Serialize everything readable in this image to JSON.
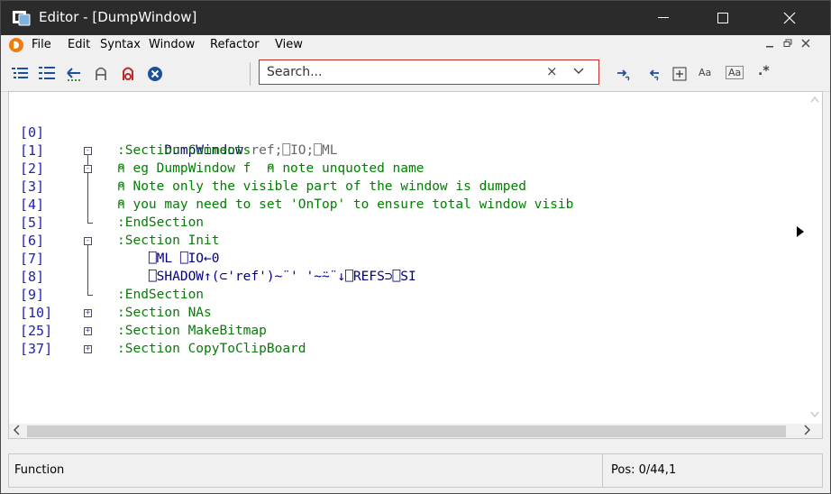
{
  "window": {
    "title": "Editor - [DumpWindow]"
  },
  "menu": {
    "items": [
      "File",
      "Edit",
      "Syntax",
      "Window",
      "Refactor",
      "View"
    ]
  },
  "toolbar": {
    "icons": [
      "outline-list-icon",
      "outline-list-alt-icon",
      "go-back-icon",
      "lock-icon",
      "unlock-icon",
      "cancel-icon"
    ],
    "search": {
      "placeholder": "Search...",
      "clear_glyph": "×"
    },
    "find_options": [
      "find-next-icon",
      "find-previous-icon",
      "expand-box-icon"
    ],
    "match_case_label": "Aa",
    "whole_word_label": "Aa",
    "regex_label": ".*"
  },
  "editor": {
    "line_numbers": [
      "[0]",
      "[1]",
      "[2]",
      "[3]",
      "[4]",
      "[5]",
      "[6]",
      "[7]",
      "[8]",
      "[9]",
      "[10]",
      "[25]",
      "[37]"
    ],
    "lines": {
      "l0": {
        "name": "DumpWindow",
        "args": " ref;⎕IO;⎕ML"
      },
      "l1": ":Section Comments",
      "l2": "⍝ eg DumpWindow f  ⍝ note unquoted name",
      "l3": "⍝ Note only the visible part of the window is dumped",
      "l4": "⍝ you may need to set 'OnTop' to ensure total window visib",
      "l5": ":EndSection",
      "l6": ":Section Init",
      "l7": "    ⎕ML ⎕IO←0",
      "l8": "    ⎕SHADOW↑(⊂'ref')~¨' '~⍨¨↓⎕REFS⊃⎕SI",
      "l9": ":EndSection",
      "l10": ":Section NAs",
      "l25": ":Section MakeBitmap",
      "l37": ":Section CopyToClipBoard"
    }
  },
  "status": {
    "left": "Function",
    "right": "Pos: 0/44,1"
  },
  "colors": {
    "titlebar": "#2b2b2b",
    "search_border": "#c5302a",
    "line_number": "#1f1fb5",
    "comment": "#008000"
  }
}
